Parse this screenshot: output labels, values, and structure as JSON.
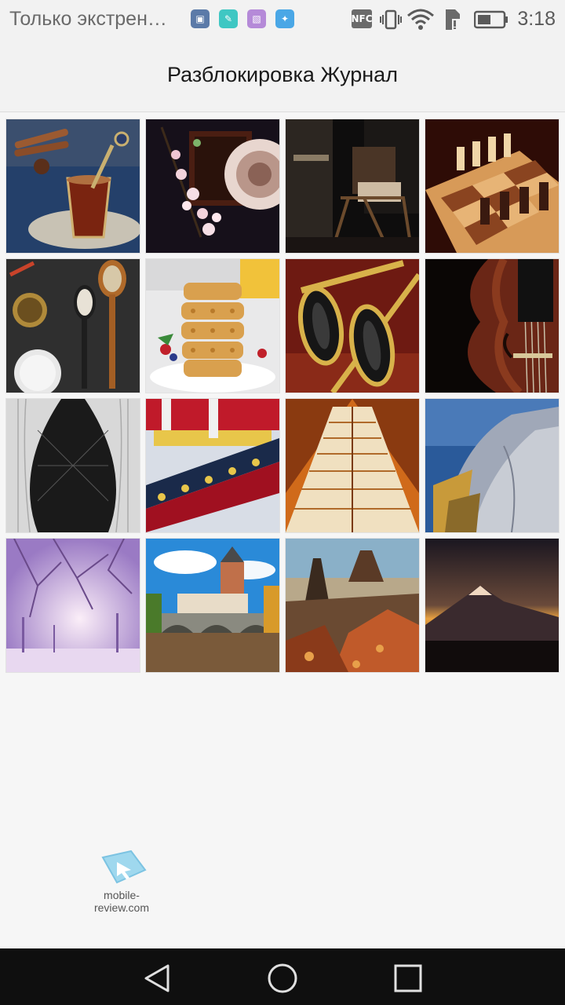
{
  "status_bar": {
    "carrier_text": "Только экстрен…",
    "time": "3:18",
    "notification_icons": [
      "lvlup-app-icon",
      "pen-app-icon",
      "gallery-app-icon",
      "twitter-icon"
    ],
    "system_icons": [
      "nfc-icon",
      "vibrate-icon",
      "wifi-icon",
      "sim-icon",
      "battery-icon"
    ],
    "nfc_label": "NFC"
  },
  "header": {
    "title": "Разблокировка Журнал"
  },
  "gallery": {
    "images": [
      "tea-and-cinnamon",
      "cherry-blossom-tray",
      "folding-chair-interior",
      "chess-board",
      "spices-and-spoons",
      "waffle-stack",
      "golf-club-heads",
      "violin-closeup",
      "white-arches",
      "pagoda-roof",
      "escalator-geometry",
      "metal-building",
      "winter-forest",
      "castle-bridge",
      "desert-rock",
      "mountain-sunset"
    ]
  },
  "watermark": {
    "text": "mobile-review.com"
  },
  "nav_bar": {
    "buttons": [
      "back-button",
      "home-button",
      "recents-button"
    ]
  }
}
